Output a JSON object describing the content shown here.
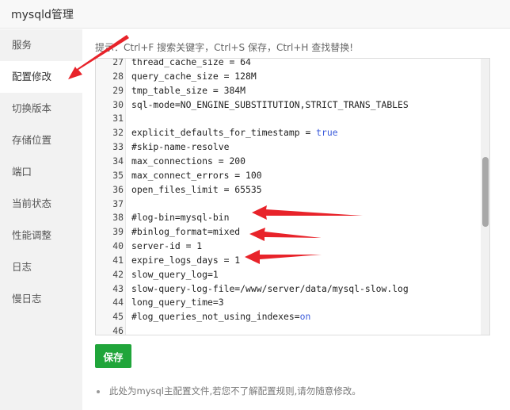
{
  "window": {
    "title": "mysqld管理"
  },
  "sidebar": {
    "items": [
      {
        "label": "服务"
      },
      {
        "label": "配置修改",
        "active": true
      },
      {
        "label": "切换版本"
      },
      {
        "label": "存储位置"
      },
      {
        "label": "端口"
      },
      {
        "label": "当前状态"
      },
      {
        "label": "性能调整"
      },
      {
        "label": "日志"
      },
      {
        "label": "慢日志"
      }
    ]
  },
  "editor": {
    "hint": "提示：Ctrl+F 搜索关键字，Ctrl+S 保存，Ctrl+H 查找替换!",
    "lines": [
      {
        "num": "27",
        "code": "thread_cache_size = 64"
      },
      {
        "num": "28",
        "code": "query_cache_size = 128M"
      },
      {
        "num": "29",
        "code": "tmp_table_size = 384M"
      },
      {
        "num": "30",
        "code": "sql-mode=NO_ENGINE_SUBSTITUTION,STRICT_TRANS_TABLES"
      },
      {
        "num": "31",
        "code": ""
      },
      {
        "num": "32",
        "code": "explicit_defaults_for_timestamp = ",
        "kw": "true"
      },
      {
        "num": "33",
        "code": "#skip-name-resolve"
      },
      {
        "num": "34",
        "code": "max_connections = 200"
      },
      {
        "num": "35",
        "code": "max_connect_errors = 100"
      },
      {
        "num": "36",
        "code": "open_files_limit = 65535"
      },
      {
        "num": "37",
        "code": ""
      },
      {
        "num": "38",
        "code": "#log-bin=mysql-bin"
      },
      {
        "num": "39",
        "code": "#binlog_format=mixed"
      },
      {
        "num": "40",
        "code": "server-id = 1"
      },
      {
        "num": "41",
        "code": "expire_logs_days = 1"
      },
      {
        "num": "42",
        "code": "slow_query_log=1"
      },
      {
        "num": "43",
        "code": "slow-query-log-file=/www/server/data/mysql-slow.log"
      },
      {
        "num": "44",
        "code": "long_query_time=3"
      },
      {
        "num": "45",
        "code": "#log_queries_not_using_indexes=",
        "kw": "on"
      },
      {
        "num": "46",
        "code": ""
      }
    ]
  },
  "save_button": {
    "label": "保存"
  },
  "note": {
    "text": "此处为mysql主配置文件,若您不了解配置规则,请勿随意修改。"
  },
  "colors": {
    "save_green": "#20a53a",
    "arrow_red": "#e8232a",
    "keyword_blue": "#3b5bdb"
  }
}
